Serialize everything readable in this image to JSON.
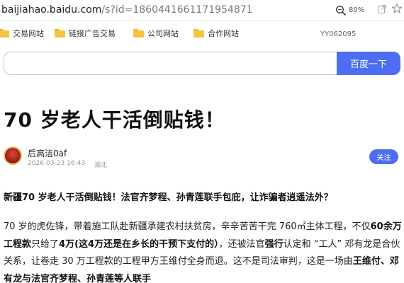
{
  "browser": {
    "url_domain": "baijiahao.baidu.com",
    "url_path": "/s?id=1860441661171954871",
    "zoom": "80%"
  },
  "bookmarks": {
    "items": [
      {
        "label": "交易网站"
      },
      {
        "label": "链接广告交易"
      },
      {
        "label": "公司网站"
      },
      {
        "label": "合作网站"
      }
    ],
    "code": "YY062095"
  },
  "search": {
    "value": "",
    "button_label": "百度一下"
  },
  "article": {
    "title": "70 岁老人干活倒贴钱！",
    "author": "后高洁0af",
    "time": "2026-03-23 16:43",
    "location": "湖北",
    "follow_label": "关注",
    "lead": "新疆70 岁老人干活倒贴钱！法官齐梦程、孙青莲联手包庇，让诈骗者逍遥法外？",
    "para": [
      {
        "t": "70 岁的虎佐锋，带着施工队赴新疆承建农村扶贫房，辛辛苦苦干完 760㎡主体工程，不仅",
        "b": false
      },
      {
        "t": "60余万工程款",
        "b": true
      },
      {
        "t": "只给了",
        "b": false
      },
      {
        "t": "4万(这4万还是在乡长的干预下支付的）",
        "b": true
      },
      {
        "t": "，还被法官",
        "b": false
      },
      {
        "t": "强行",
        "b": true
      },
      {
        "t": "认定和 “工人” 邓有龙是合伙关系，让卷走 30 万工程款的工程甲方王维付全身而退。这不是司法审判，这是一场由",
        "b": false
      },
      {
        "t": "王维付、邓有龙与法官齐梦程、孙青莲等人联手",
        "b": true
      }
    ]
  }
}
